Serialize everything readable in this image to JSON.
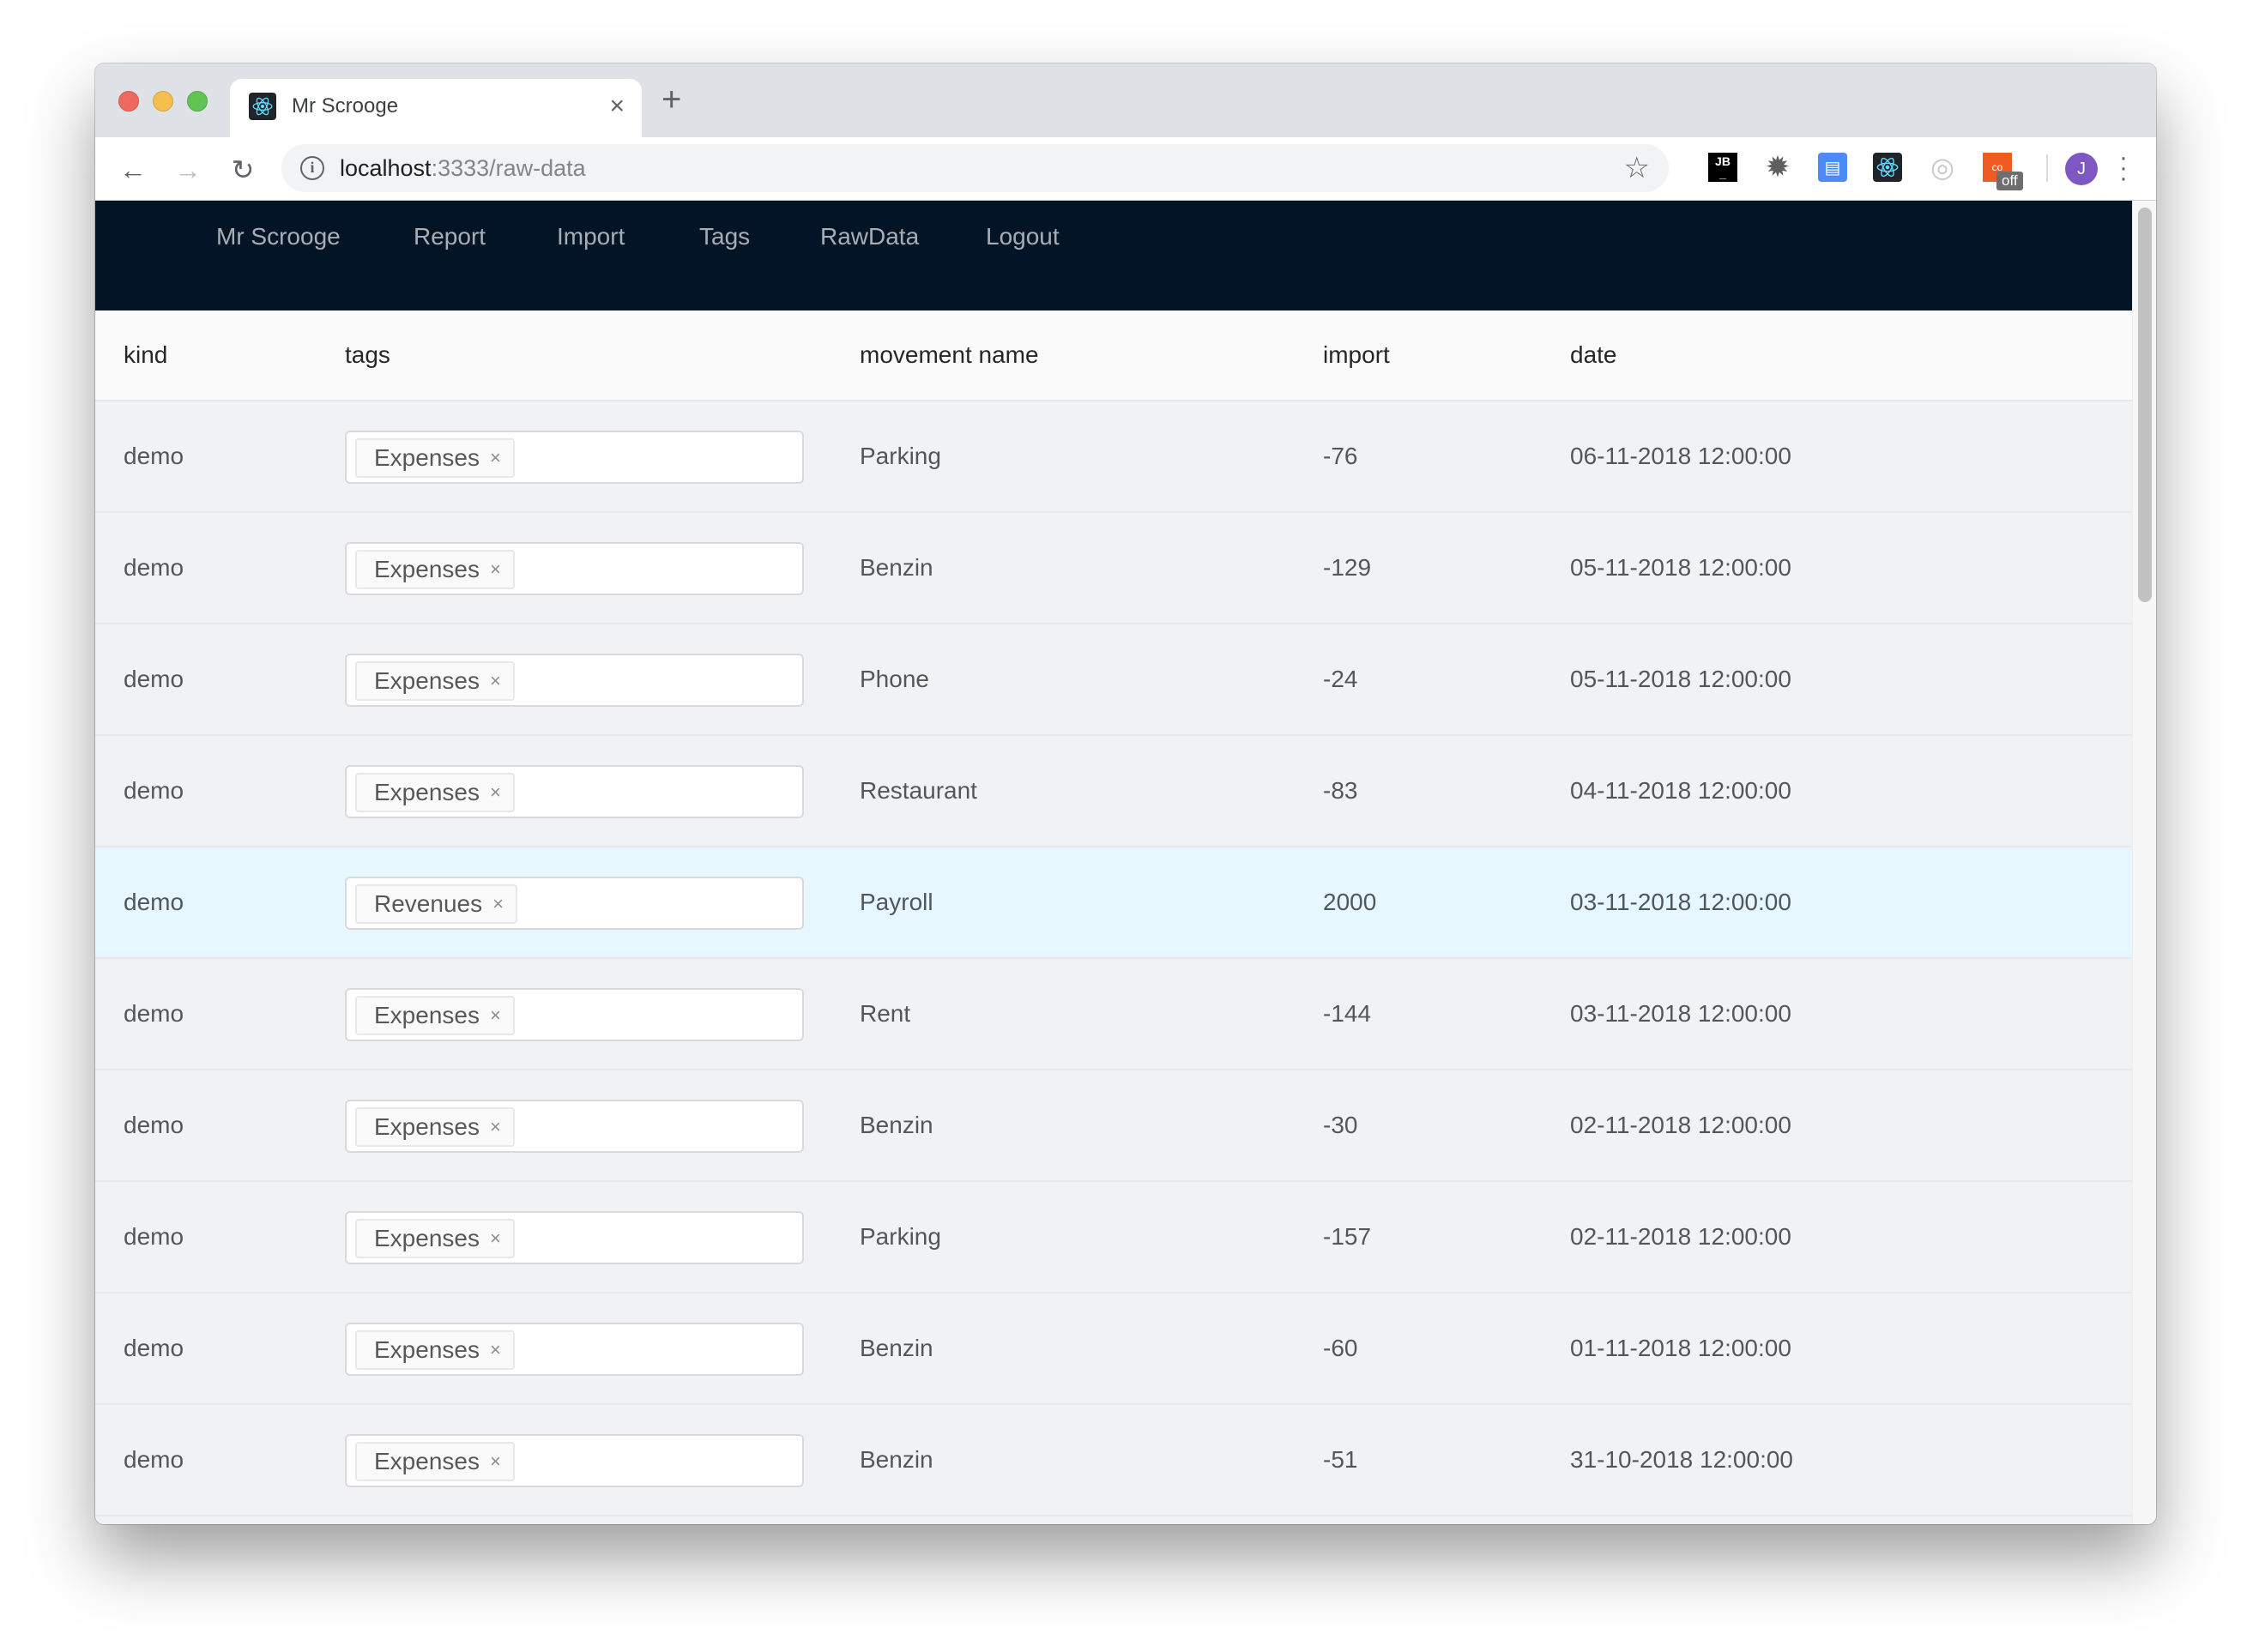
{
  "browser": {
    "tab_title": "Mr Scrooge",
    "tab_close": "×",
    "new_tab": "+",
    "url_host": "localhost",
    "url_rest": ":3333/raw-data",
    "profile_initial": "J",
    "extensions": [
      "jetbrains-icon",
      "bug-gear-icon",
      "reader-icon",
      "react-devtools-icon",
      "target-icon",
      "compat-off-icon"
    ],
    "ext_off_label": "off"
  },
  "appnav": {
    "items": [
      "Mr Scrooge",
      "Report",
      "Import",
      "Tags",
      "RawData",
      "Logout"
    ]
  },
  "table": {
    "columns": [
      "kind",
      "tags",
      "movement name",
      "import",
      "date"
    ],
    "rows": [
      {
        "kind": "demo",
        "tag": "Expenses",
        "name": "Parking",
        "import": "-76",
        "date": "06-11-2018 12:00:00"
      },
      {
        "kind": "demo",
        "tag": "Expenses",
        "name": "Benzin",
        "import": "-129",
        "date": "05-11-2018 12:00:00"
      },
      {
        "kind": "demo",
        "tag": "Expenses",
        "name": "Phone",
        "import": "-24",
        "date": "05-11-2018 12:00:00"
      },
      {
        "kind": "demo",
        "tag": "Expenses",
        "name": "Restaurant",
        "import": "-83",
        "date": "04-11-2018 12:00:00"
      },
      {
        "kind": "demo",
        "tag": "Revenues",
        "name": "Payroll",
        "import": "2000",
        "date": "03-11-2018 12:00:00"
      },
      {
        "kind": "demo",
        "tag": "Expenses",
        "name": "Rent",
        "import": "-144",
        "date": "03-11-2018 12:00:00"
      },
      {
        "kind": "demo",
        "tag": "Expenses",
        "name": "Benzin",
        "import": "-30",
        "date": "02-11-2018 12:00:00"
      },
      {
        "kind": "demo",
        "tag": "Expenses",
        "name": "Parking",
        "import": "-157",
        "date": "02-11-2018 12:00:00"
      },
      {
        "kind": "demo",
        "tag": "Expenses",
        "name": "Benzin",
        "import": "-60",
        "date": "01-11-2018 12:00:00"
      },
      {
        "kind": "demo",
        "tag": "Expenses",
        "name": "Benzin",
        "import": "-51",
        "date": "31-10-2018 12:00:00"
      }
    ],
    "highlighted_row_index": 4,
    "tag_remove_glyph": "×"
  },
  "colors": {
    "nav_bg": "#041427",
    "row_bg": "#f0f2f5",
    "highlight_bg": "#e6f7ff"
  }
}
